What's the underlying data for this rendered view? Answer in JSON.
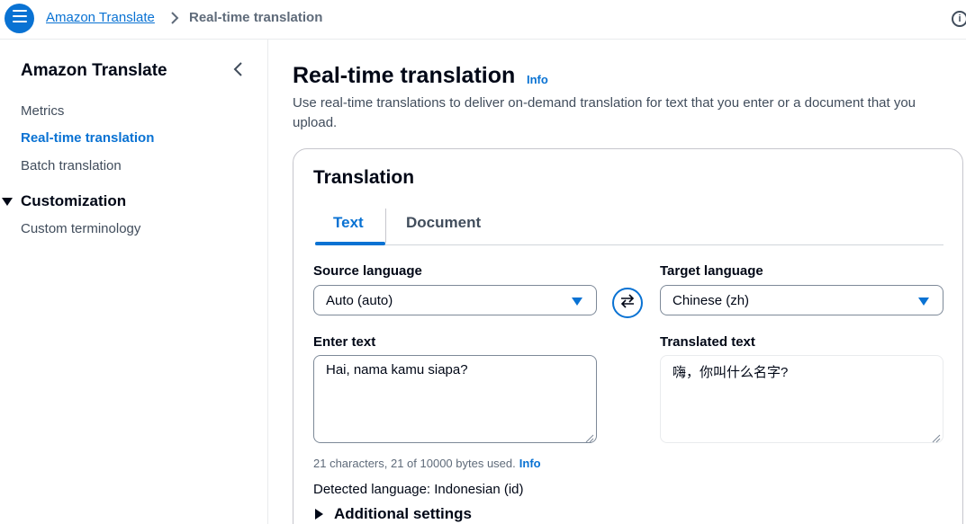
{
  "topbar": {
    "breadcrumb_root": "Amazon Translate",
    "breadcrumb_current": "Real-time translation",
    "info_glyph": "i"
  },
  "sidebar": {
    "title": "Amazon Translate",
    "items": [
      {
        "label": "Metrics",
        "active": false
      },
      {
        "label": "Real-time translation",
        "active": true
      },
      {
        "label": "Batch translation",
        "active": false
      }
    ],
    "section": {
      "label": "Customization",
      "expanded": true,
      "items": [
        {
          "label": "Custom terminology"
        }
      ]
    }
  },
  "main": {
    "title": "Real-time translation",
    "title_info": "Info",
    "description": "Use real-time translations to deliver on-demand translation for text that you enter or a document that you upload."
  },
  "card": {
    "title": "Translation",
    "tabs": [
      {
        "label": "Text",
        "selected": true
      },
      {
        "label": "Document",
        "selected": false
      }
    ],
    "source": {
      "label": "Source language",
      "value": "Auto (auto)"
    },
    "target": {
      "label": "Target language",
      "value": "Chinese (zh)"
    },
    "input": {
      "label": "Enter text",
      "value": "Hai, nama kamu siapa?"
    },
    "output": {
      "label": "Translated text",
      "value": "嗨，你叫什么名字?"
    },
    "counter": "21 characters, 21 of 10000 bytes used.",
    "counter_info": "Info",
    "detected": "Detected language: Indonesian (id)",
    "additional": "Additional settings"
  },
  "colors": {
    "accent": "#0972d3",
    "text": "#000716",
    "muted": "#414d5c",
    "border": "#7d8998"
  }
}
